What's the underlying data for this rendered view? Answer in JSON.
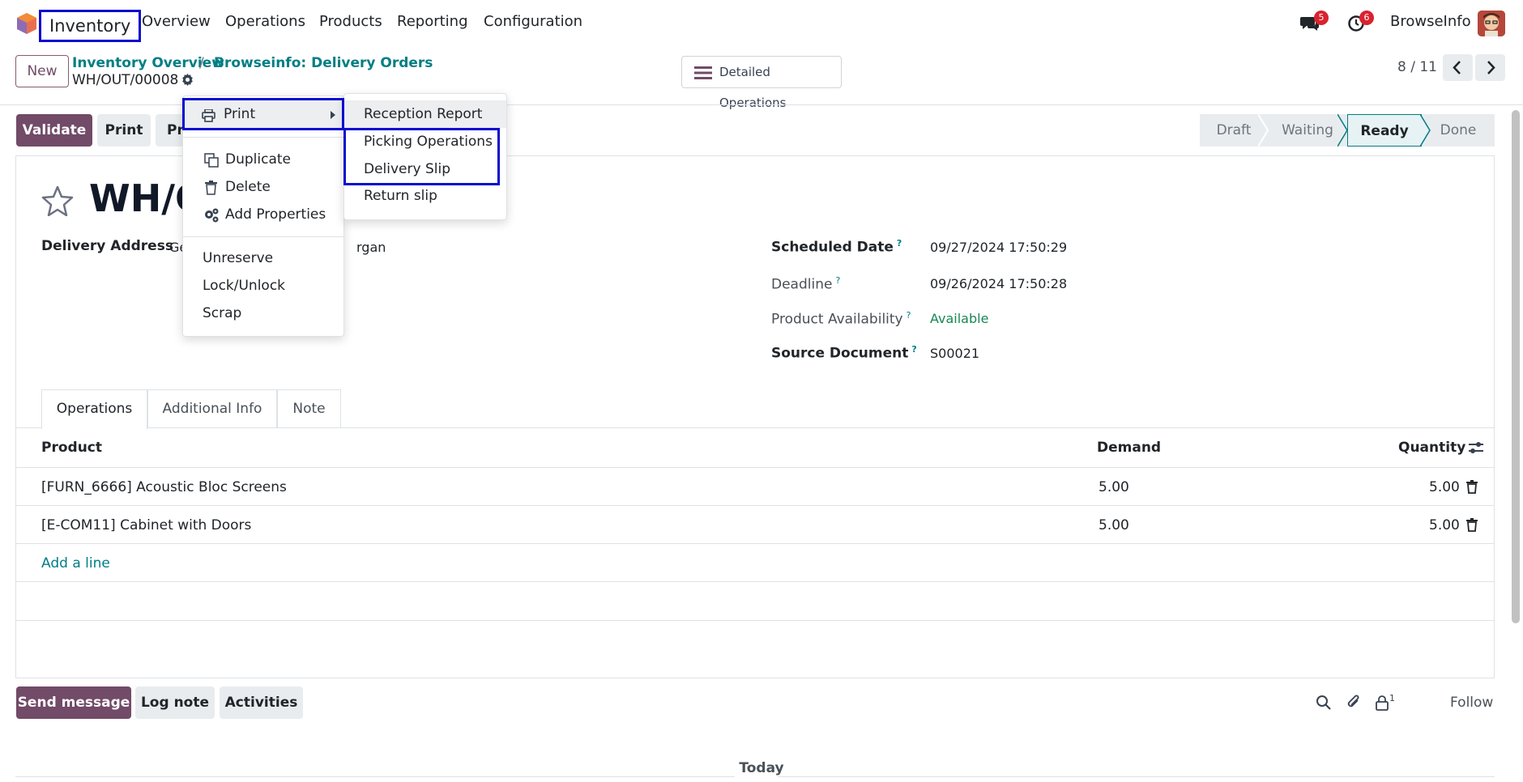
{
  "navbar": {
    "app_name": "Inventory",
    "menu": [
      "Overview",
      "Operations",
      "Products",
      "Reporting",
      "Configuration"
    ],
    "messages_count": "5",
    "activities_count": "6",
    "company": "BrowseInfo"
  },
  "control_panel": {
    "new_label": "New",
    "breadcrumb": [
      "Inventory Overview",
      "Browseinfo: Delivery Orders"
    ],
    "record_name": "WH/OUT/00008",
    "detailed_operations": "Detailed Operations",
    "pager": "8 / 11"
  },
  "actions": {
    "validate": "Validate",
    "print": "Print",
    "print_partial": "Pr"
  },
  "statusbar": [
    "Draft",
    "Waiting",
    "Ready",
    "Done"
  ],
  "statusbar_active": "Ready",
  "gear_menu": {
    "print": "Print",
    "items": [
      "Duplicate",
      "Delete",
      "Add Properties"
    ],
    "items2": [
      "Unreserve",
      "Lock/Unlock",
      "Scrap"
    ]
  },
  "print_submenu": [
    "Reception Report",
    "Picking Operations",
    "Delivery Slip",
    "Return slip"
  ],
  "form": {
    "title_partial": "WH/O",
    "delivery_address_label": "Delivery Address",
    "delivery_address_left": "Ge",
    "delivery_address_right": "rgan",
    "scheduled_date_label": "Scheduled Date",
    "scheduled_date": "09/27/2024 17:50:29",
    "deadline_label": "Deadline",
    "deadline": "09/26/2024 17:50:28",
    "availability_label": "Product Availability",
    "availability": "Available",
    "source_label": "Source Document",
    "source": "S00021",
    "help_mark": "?"
  },
  "tabs": [
    "Operations",
    "Additional Info",
    "Note"
  ],
  "table": {
    "headers": [
      "Product",
      "Demand",
      "Quantity"
    ],
    "rows": [
      {
        "product": "[FURN_6666] Acoustic Bloc Screens",
        "demand": "5.00",
        "quantity": "5.00"
      },
      {
        "product": "[E-COM11] Cabinet with Doors",
        "demand": "5.00",
        "quantity": "5.00"
      }
    ],
    "add_line": "Add a line"
  },
  "chatter": {
    "send_message": "Send message",
    "log_note": "Log note",
    "activities": "Activities",
    "followers_count": "1",
    "follow": "Follow",
    "today": "Today"
  },
  "colors": {
    "primary": "#714b67",
    "link": "#017e84",
    "highlight": "#0a0acf",
    "available": "#28a745"
  }
}
